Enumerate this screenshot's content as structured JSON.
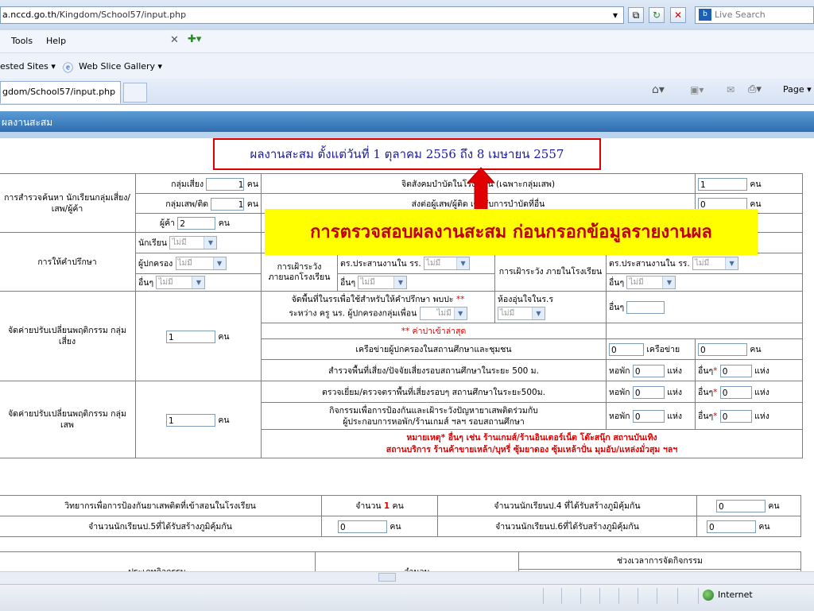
{
  "browser": {
    "url_host": "a.nccd.go.th",
    "url_path": "/Kingdom/School57/input.php",
    "search_placeholder": "Live Search",
    "live_logo": "b",
    "menu": {
      "tools": "Tools",
      "help": "Help"
    },
    "favorites": {
      "suggested": "ested Sites ▾",
      "webslice": "Web Slice Gallery ▾"
    },
    "tab_title": "gdom/School57/input.php",
    "page_menu": "Page ▾",
    "status_zone": "Internet"
  },
  "page": {
    "header": "ผลงานสะสม",
    "title": "ผลงานสะสม ตั้งแต่วันที่ 1 ตุลาคม 2556 ถึง  8  เมษายน 2557",
    "banner": "การตรวจสอบผลงานสะสม ก่อนกรอกข้อมูลรายงานผล",
    "unit_person": "คน",
    "unit_place": "แห่ง",
    "unit_network": "เครือข่าย",
    "select_none": "ไม่มี",
    "colors": {
      "accent_red": "#e00000",
      "title_blue": "#1a1aa0",
      "banner_yellow": "#ffff00",
      "header_blue": "#3a7cc0"
    }
  },
  "survey": {
    "label": "การสำรวจค้นหา นักเรียนกลุ่มเสี่ยง/เสพ/ผู้ค้า",
    "risk_label": "กลุ่มเสี่ยง",
    "risk_value": "1",
    "user_label": "กลุ่มเสพ/ติด",
    "user_value": "1",
    "dealer_label": "ผู้ค้า",
    "dealer_value": "2",
    "r1_text": "จิตสังคมบำบัดในโรงเรียน (เฉพาะกลุ่มเสพ)",
    "r1_value": "1",
    "r2_text": "ส่งต่อผู้เสพ/ผู้ติด เข้ารับการบำบัดที่อื่น",
    "r2_value": "0"
  },
  "counsel": {
    "label": "การให้คำปรึกษา",
    "student": "นักเรียน",
    "parent": "ผู้ปกครอง",
    "other": "อื่นๆ",
    "outside_label": "การเฝ้าระวัง ภายนอกโรงเรียน",
    "inside_label": "การเฝ้าระวัง ภายในโรงเรียน",
    "coord_label": "ตร.ประสานงานใน รร."
  },
  "camp_risk": {
    "label": "จัดค่ายปรับเปลี่ยนพฤติกรรม กลุ่มเสี่ยง",
    "value": "1",
    "area_text": "จัดพื้นที่ในรรเพื่อใช้สำหรับให้คำปรึกษา พบปะ",
    "area_text2": "ระหว่าง ครู นร. ผู้ปกครองกลุ่มเพื่อน",
    "stars": "**",
    "room_text": "ห้องอุ่นใจในร.ร",
    "other": "อื่นๆ",
    "latest_note": "** ค่าปาเข้าล่าสุด",
    "network_text": "เครือข่ายผู้ปกครองในสถานศึกษาและชุมชน",
    "network_value": "0",
    "network_people": "0",
    "survey500_text": "สำรวจพื้นที่เสี่ยง/ปัจจัยเสี่ยงรอบสถานศึกษาในระยะ 500 ม.",
    "dorm": "หอพัก",
    "other_star": "อื่นๆ",
    "v_dorm": "0",
    "v_other": "0"
  },
  "camp_user": {
    "label": "จัดค่ายปรับเปลี่ยนพฤติกรรม กลุ่มเสพ",
    "value": "1",
    "visit_text": "ตรวจเยี่ยม/ตรวจตราพื้นที่เสี่ยงรอบๆ สถานศึกษาในระยะ500ม.",
    "activity_text1": "กิจกรรมเพื่อการป้องกันและเฝ้าระวังปัญหายาเสพติดร่วมกับ",
    "activity_text2": "ผู้ประกอบการหอพัก/ร้านเกมส์ ฯลฯ รอบสถานศึกษา",
    "v1_dorm": "0",
    "v1_other": "0",
    "v2_dorm": "0",
    "v2_other": "0",
    "note1": "หมายเหตุ* อื่นๆ เช่น ร้านเกมส์/ร้านอินเตอร์เน็ต โต๊ะสนุ๊ก สถานบันเทิง",
    "note2": "สถานบริการ ร้านค้าขายเหล้า/บุหรี่ ซุ้มยาดอง ซุ้มเหล้าปั่น มุมอับ/แหล่งมั่วสุม ฯลฯ"
  },
  "summary": {
    "lecturer_label": "วิทยากรเพื่อการป้องกันยาเสพติดที่เข้าสอนในโรงเรียน",
    "amount_label": "จำนวน",
    "lecturer_value": "1",
    "p4_label": "จำนวนนักเรียนป.4 ที่ได้รับสร้างภูมิคุ้มกัน",
    "p4_value": "0",
    "p5_label": "จำนวนนักเรียนป.5ที่ได้รับสร้างภูมิคุ้มกัน",
    "p5_value": "0",
    "p6_label": "จำนวนนักเรียนป.6ที่ได้รับสร้างภูมิคุ้มกัน",
    "p6_value": "0"
  },
  "activity": {
    "type_label": "ประเภทกิจกรรม",
    "amount_label": "จำนวน",
    "period_label": "ช่วงเวลาการจัดกิจกรรม"
  }
}
